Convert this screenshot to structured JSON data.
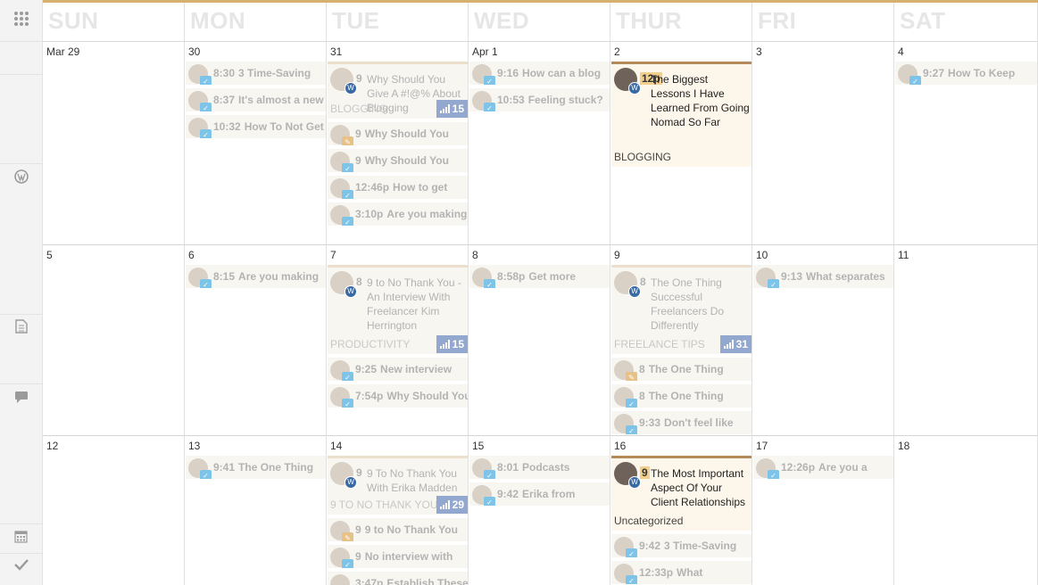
{
  "days": [
    "SUN",
    "MON",
    "TUE",
    "WED",
    "THUR",
    "FRI",
    "SAT"
  ],
  "sidebar_icons": [
    "grid-icon",
    "wordpress-icon",
    "document-icon",
    "comment-icon",
    "calendar-icon",
    "check-icon"
  ],
  "weeks": [
    {
      "dates": [
        "Mar 29",
        "30",
        "31",
        "Apr 1",
        "2",
        "3",
        "4"
      ]
    },
    {
      "dates": [
        "5",
        "6",
        "7",
        "8",
        "9",
        "10",
        "11"
      ]
    },
    {
      "dates": [
        "12",
        "13",
        "14",
        "15",
        "16",
        "17",
        "18"
      ]
    }
  ],
  "posts": {
    "w0mon": [
      {
        "time": "8:30",
        "title": "3 Time-Saving",
        "icon": "twitter-icon"
      },
      {
        "time": "8:37",
        "title": "It's almost a new",
        "icon": "twitter-icon"
      },
      {
        "time": "10:32",
        "title": "How To Not Get",
        "icon": "twitter-icon"
      }
    ],
    "w0tue_card": {
      "time": "9",
      "title": "Why Should You Give A #!@% About Blogging",
      "category": "BLOGGING",
      "count": "15"
    },
    "w0tue": [
      {
        "time": "9",
        "title": "Why Should You",
        "icon": "pinterest-icon"
      },
      {
        "time": "9",
        "title": "Why Should You",
        "icon": "twitter-icon"
      },
      {
        "time": "12:46p",
        "title": "How to get",
        "icon": "twitter-icon"
      },
      {
        "time": "3:10p",
        "title": "Are you making",
        "icon": "twitter-icon"
      }
    ],
    "w0wed": [
      {
        "time": "9:16",
        "title": "How can a blog",
        "icon": "twitter-icon"
      },
      {
        "time": "10:53",
        "title": "Feeling stuck?",
        "icon": "twitter-icon"
      }
    ],
    "w0thu_card": {
      "time": "12p",
      "title": "The Biggest Lessons I Have Learned From Going Nomad So Far",
      "category": "BLOGGING"
    },
    "w0sat": [
      {
        "time": "9:27",
        "title": "How To Keep",
        "icon": "twitter-icon"
      }
    ],
    "w1mon": [
      {
        "time": "8:15",
        "title": "Are you making",
        "icon": "twitter-icon"
      }
    ],
    "w1tue_card": {
      "time": "8",
      "title": "9 to No Thank You - An Interview With Freelancer Kim Herrington",
      "category": "PRODUCTIVITY",
      "count": "15"
    },
    "w1tue": [
      {
        "time": "9:25",
        "title": "New interview",
        "icon": "twitter-icon"
      },
      {
        "time": "7:54p",
        "title": "Why Should You",
        "icon": "twitter-icon"
      }
    ],
    "w1wed": [
      {
        "time": "8:58p",
        "title": "Get more",
        "icon": "twitter-icon"
      }
    ],
    "w1thu_card": {
      "time": "8",
      "title": "The One Thing Successful Freelancers Do Differently",
      "category": "FREELANCE TIPS",
      "count": "31"
    },
    "w1thu": [
      {
        "time": "8",
        "title": "The One Thing",
        "icon": "pinterest-icon"
      },
      {
        "time": "8",
        "title": "The One Thing",
        "icon": "twitter-icon"
      },
      {
        "time": "9:33",
        "title": "Don't feel like",
        "icon": "twitter-icon"
      }
    ],
    "w1fri": [
      {
        "time": "9:13",
        "title": "What separates",
        "icon": "twitter-icon"
      }
    ],
    "w2mon": [
      {
        "time": "9:41",
        "title": "The One Thing",
        "icon": "twitter-icon"
      }
    ],
    "w2tue_card": {
      "time": "9",
      "title": "9 To No Thank You With Erika Madden",
      "category": "9 TO NO THANK YOU",
      "count": "29"
    },
    "w2tue": [
      {
        "time": "9",
        "title": "9 to No Thank You",
        "icon": "pinterest-icon"
      },
      {
        "time": "9",
        "title": "No interview with",
        "icon": "twitter-icon"
      },
      {
        "time": "3:47p",
        "title": "Establish These",
        "icon": "twitter-icon"
      }
    ],
    "w2wed": [
      {
        "time": "8:01",
        "title": "Podcasts",
        "icon": "twitter-icon"
      },
      {
        "time": "9:42",
        "title": "Erika from",
        "icon": "twitter-icon"
      }
    ],
    "w2thu_card": {
      "time": "9",
      "title": "The Most Important Aspect Of Your Client Relationships",
      "category": "Uncategorized"
    },
    "w2thu": [
      {
        "time": "9:42",
        "title": "3 Time-Saving",
        "icon": "twitter-icon"
      },
      {
        "time": "12:33p",
        "title": "What",
        "icon": "twitter-icon"
      }
    ],
    "w2fri": [
      {
        "time": "12:26p",
        "title": "Are you a",
        "icon": "twitter-icon"
      }
    ]
  }
}
